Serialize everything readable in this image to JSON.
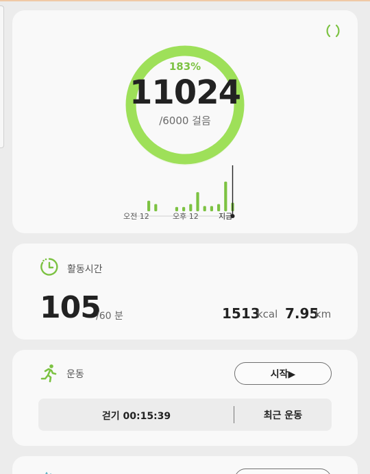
{
  "steps": {
    "percent": "183%",
    "count": "11024",
    "goal": "/6000 걸음",
    "progress": 1.0,
    "sync_icon": "sync-icon",
    "hourly_bars": [
      0.32,
      0.22,
      0.0,
      0.0,
      0.13,
      0.13,
      0.22,
      0.58,
      0.16,
      0.16,
      0.22,
      0.9,
      0.26
    ],
    "axis": {
      "start": "오전 12",
      "mid": "오후 12",
      "now": "지금"
    },
    "accent_color": "#7cc242",
    "ring_color": "#9ee059"
  },
  "activity": {
    "icon": "clock-icon",
    "title": "활동시간",
    "minutes": "105",
    "goal": "/60 분",
    "kcal_value": "1513",
    "kcal_unit": "kcal",
    "distance_value": "7.95",
    "distance_unit": "km"
  },
  "exercise": {
    "icon": "running-person-icon",
    "title": "운동",
    "start_label": "시작▶",
    "last_workout": "걷기  00:15:39",
    "recent_label": "최근 운동"
  },
  "next_card": {
    "icon": "activity-icon"
  }
}
